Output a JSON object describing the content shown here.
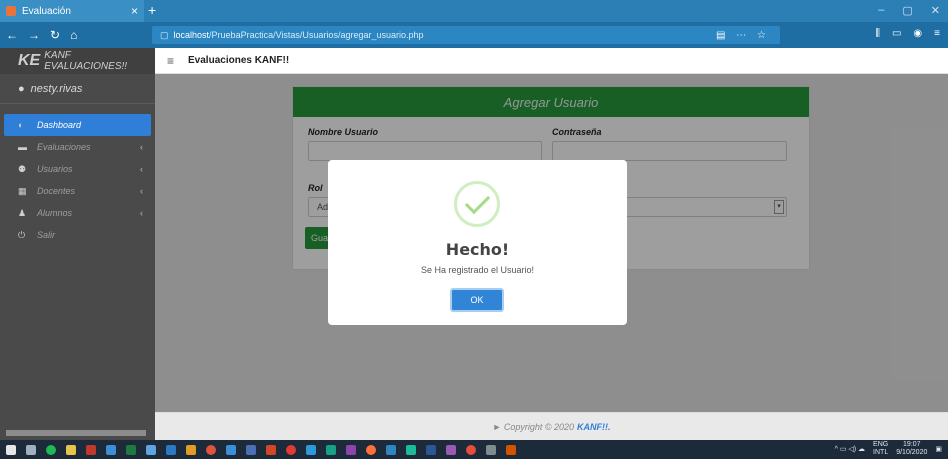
{
  "browser": {
    "tab_title": "Evaluación",
    "tab_close": "×",
    "new_tab": "+",
    "url_host": "localhost",
    "url_path": "/PruebaPractica/Vistas/Usuarios/agregar_usuario.php",
    "window_controls": [
      "–",
      "▢",
      "✕"
    ]
  },
  "sidebar": {
    "brand_logo": "KE",
    "brand_name": "KANF EVALUACIONES!!",
    "username": "nesty.rivas",
    "items": [
      {
        "label": "Dashboard",
        "icon": "dashboard-icon",
        "active": true,
        "arrow": ""
      },
      {
        "label": "Evaluaciones",
        "icon": "folder-icon",
        "active": false,
        "arrow": "‹"
      },
      {
        "label": "Usuarios",
        "icon": "users-icon",
        "active": false,
        "arrow": "‹"
      },
      {
        "label": "Docentes",
        "icon": "building-icon",
        "active": false,
        "arrow": "‹"
      },
      {
        "label": "Alumnos",
        "icon": "student-icon",
        "active": false,
        "arrow": "‹"
      },
      {
        "label": "Salir",
        "icon": "power-icon",
        "active": false,
        "arrow": ""
      }
    ]
  },
  "topbar": {
    "burger": "≡",
    "title": "Evaluaciones KANF!!"
  },
  "form": {
    "header": "Agregar Usuario",
    "username_label": "Nombre Usuario",
    "password_label": "Contraseña",
    "role_label": "Rol",
    "role_value": "Ad",
    "save_button": "Gua"
  },
  "modal": {
    "title": "Hecho!",
    "message": "Se Ha registrado el Usuario!",
    "ok_button": "OK"
  },
  "footer": {
    "prefix": "► Copyright © 2020",
    "brand": "KANF!!."
  },
  "taskbar": {
    "lang_top": "ENG",
    "lang_bottom": "INTL",
    "time": "19:07",
    "date": "9/10/2020"
  }
}
